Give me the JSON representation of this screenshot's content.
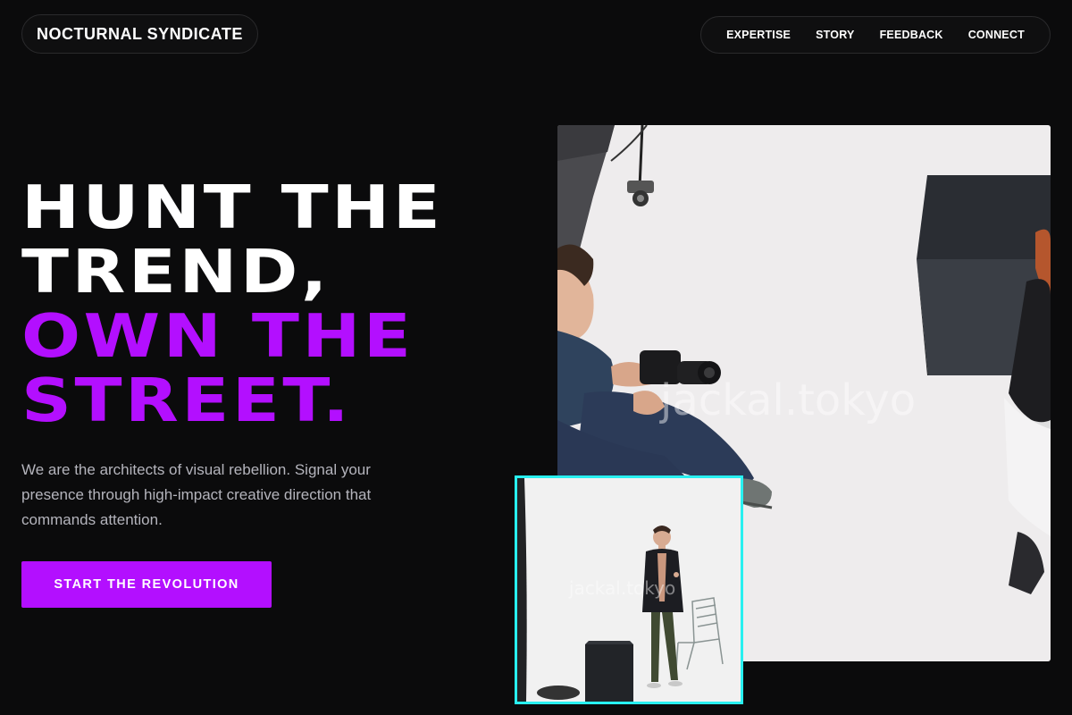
{
  "brand": {
    "name": "NOCTURNAL SYNDICATE"
  },
  "nav": {
    "items": [
      {
        "label": "EXPERTISE"
      },
      {
        "label": "STORY"
      },
      {
        "label": "FEEDBACK"
      },
      {
        "label": "CONNECT"
      }
    ]
  },
  "hero": {
    "headline_white": [
      "HUNT THE",
      "TREND,"
    ],
    "headline_purple": [
      "OWN THE",
      "STREET."
    ],
    "lead": "We are the architects of visual rebellion. Signal your presence through high-impact creative direction that commands attention.",
    "cta_label": "START THE REVOLUTION"
  },
  "images": {
    "main_watermark": "jackal.tokyo",
    "inset_watermark": "jackal.tokyo"
  },
  "colors": {
    "background": "#0b0b0c",
    "accent_purple": "#b30fff",
    "inset_border": "#28f0f0",
    "text_white": "#ffffff",
    "text_muted": "#b4b4bc"
  }
}
